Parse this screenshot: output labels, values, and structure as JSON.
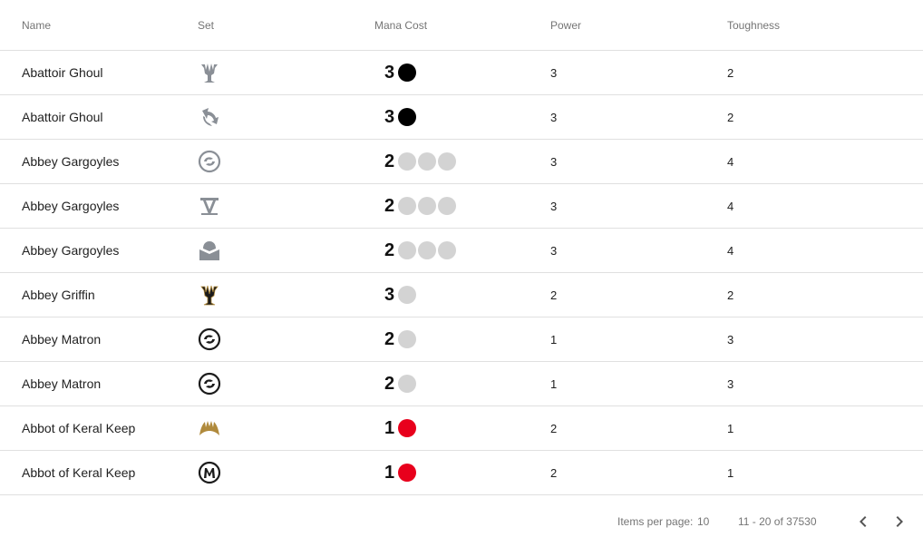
{
  "table": {
    "headers": {
      "name": "Name",
      "set": "Set",
      "mana": "Mana Cost",
      "power": "Power",
      "toughness": "Toughness"
    },
    "rows": [
      {
        "name": "Abattoir Ghoul",
        "set_icon": "set-icon-trident-grey",
        "mana_num": "3",
        "pips": [
          "black"
        ],
        "power": "3",
        "toughness": "2"
      },
      {
        "name": "Abattoir Ghoul",
        "set_icon": "set-icon-cycle-grey",
        "mana_num": "3",
        "pips": [
          "black"
        ],
        "power": "3",
        "toughness": "2"
      },
      {
        "name": "Abbey Gargoyles",
        "set_icon": "set-icon-swirl-grey",
        "mana_num": "2",
        "pips": [
          "colorless",
          "colorless",
          "colorless"
        ],
        "power": "3",
        "toughness": "4"
      },
      {
        "name": "Abbey Gargoyles",
        "set_icon": "set-icon-v-grey",
        "mana_num": "2",
        "pips": [
          "colorless",
          "colorless",
          "colorless"
        ],
        "power": "3",
        "toughness": "4"
      },
      {
        "name": "Abbey Gargoyles",
        "set_icon": "set-icon-envelope-grey",
        "mana_num": "2",
        "pips": [
          "colorless",
          "colorless",
          "colorless"
        ],
        "power": "3",
        "toughness": "4"
      },
      {
        "name": "Abbey Griffin",
        "set_icon": "set-icon-trident-black-gold",
        "mana_num": "3",
        "pips": [
          "colorless"
        ],
        "power": "2",
        "toughness": "2"
      },
      {
        "name": "Abbey Matron",
        "set_icon": "set-icon-swirl-black",
        "mana_num": "2",
        "pips": [
          "colorless"
        ],
        "power": "1",
        "toughness": "3"
      },
      {
        "name": "Abbey Matron",
        "set_icon": "set-icon-swirl-black",
        "mana_num": "2",
        "pips": [
          "colorless"
        ],
        "power": "1",
        "toughness": "3"
      },
      {
        "name": "Abbot of Keral Keep",
        "set_icon": "set-icon-flame-gold",
        "mana_num": "1",
        "pips": [
          "red"
        ],
        "power": "2",
        "toughness": "1"
      },
      {
        "name": "Abbot of Keral Keep",
        "set_icon": "set-icon-magic-origins-black",
        "mana_num": "1",
        "pips": [
          "red"
        ],
        "power": "2",
        "toughness": "1"
      }
    ]
  },
  "paginator": {
    "items_per_page_label": "Items per page:",
    "items_per_page_value": "10",
    "range_label": "11 - 20 of 37530",
    "prev_icon": "chevron-left-icon",
    "next_icon": "chevron-right-icon"
  },
  "colors": {
    "pip_black": "#000000",
    "pip_colorless": "#d3d3d3",
    "pip_red": "#e8001c",
    "set_grey": "#8a8f96",
    "set_black": "#1b1b1b",
    "set_gold": "#b08a3c",
    "divider": "#e0e0e0",
    "header_text": "#757575"
  }
}
